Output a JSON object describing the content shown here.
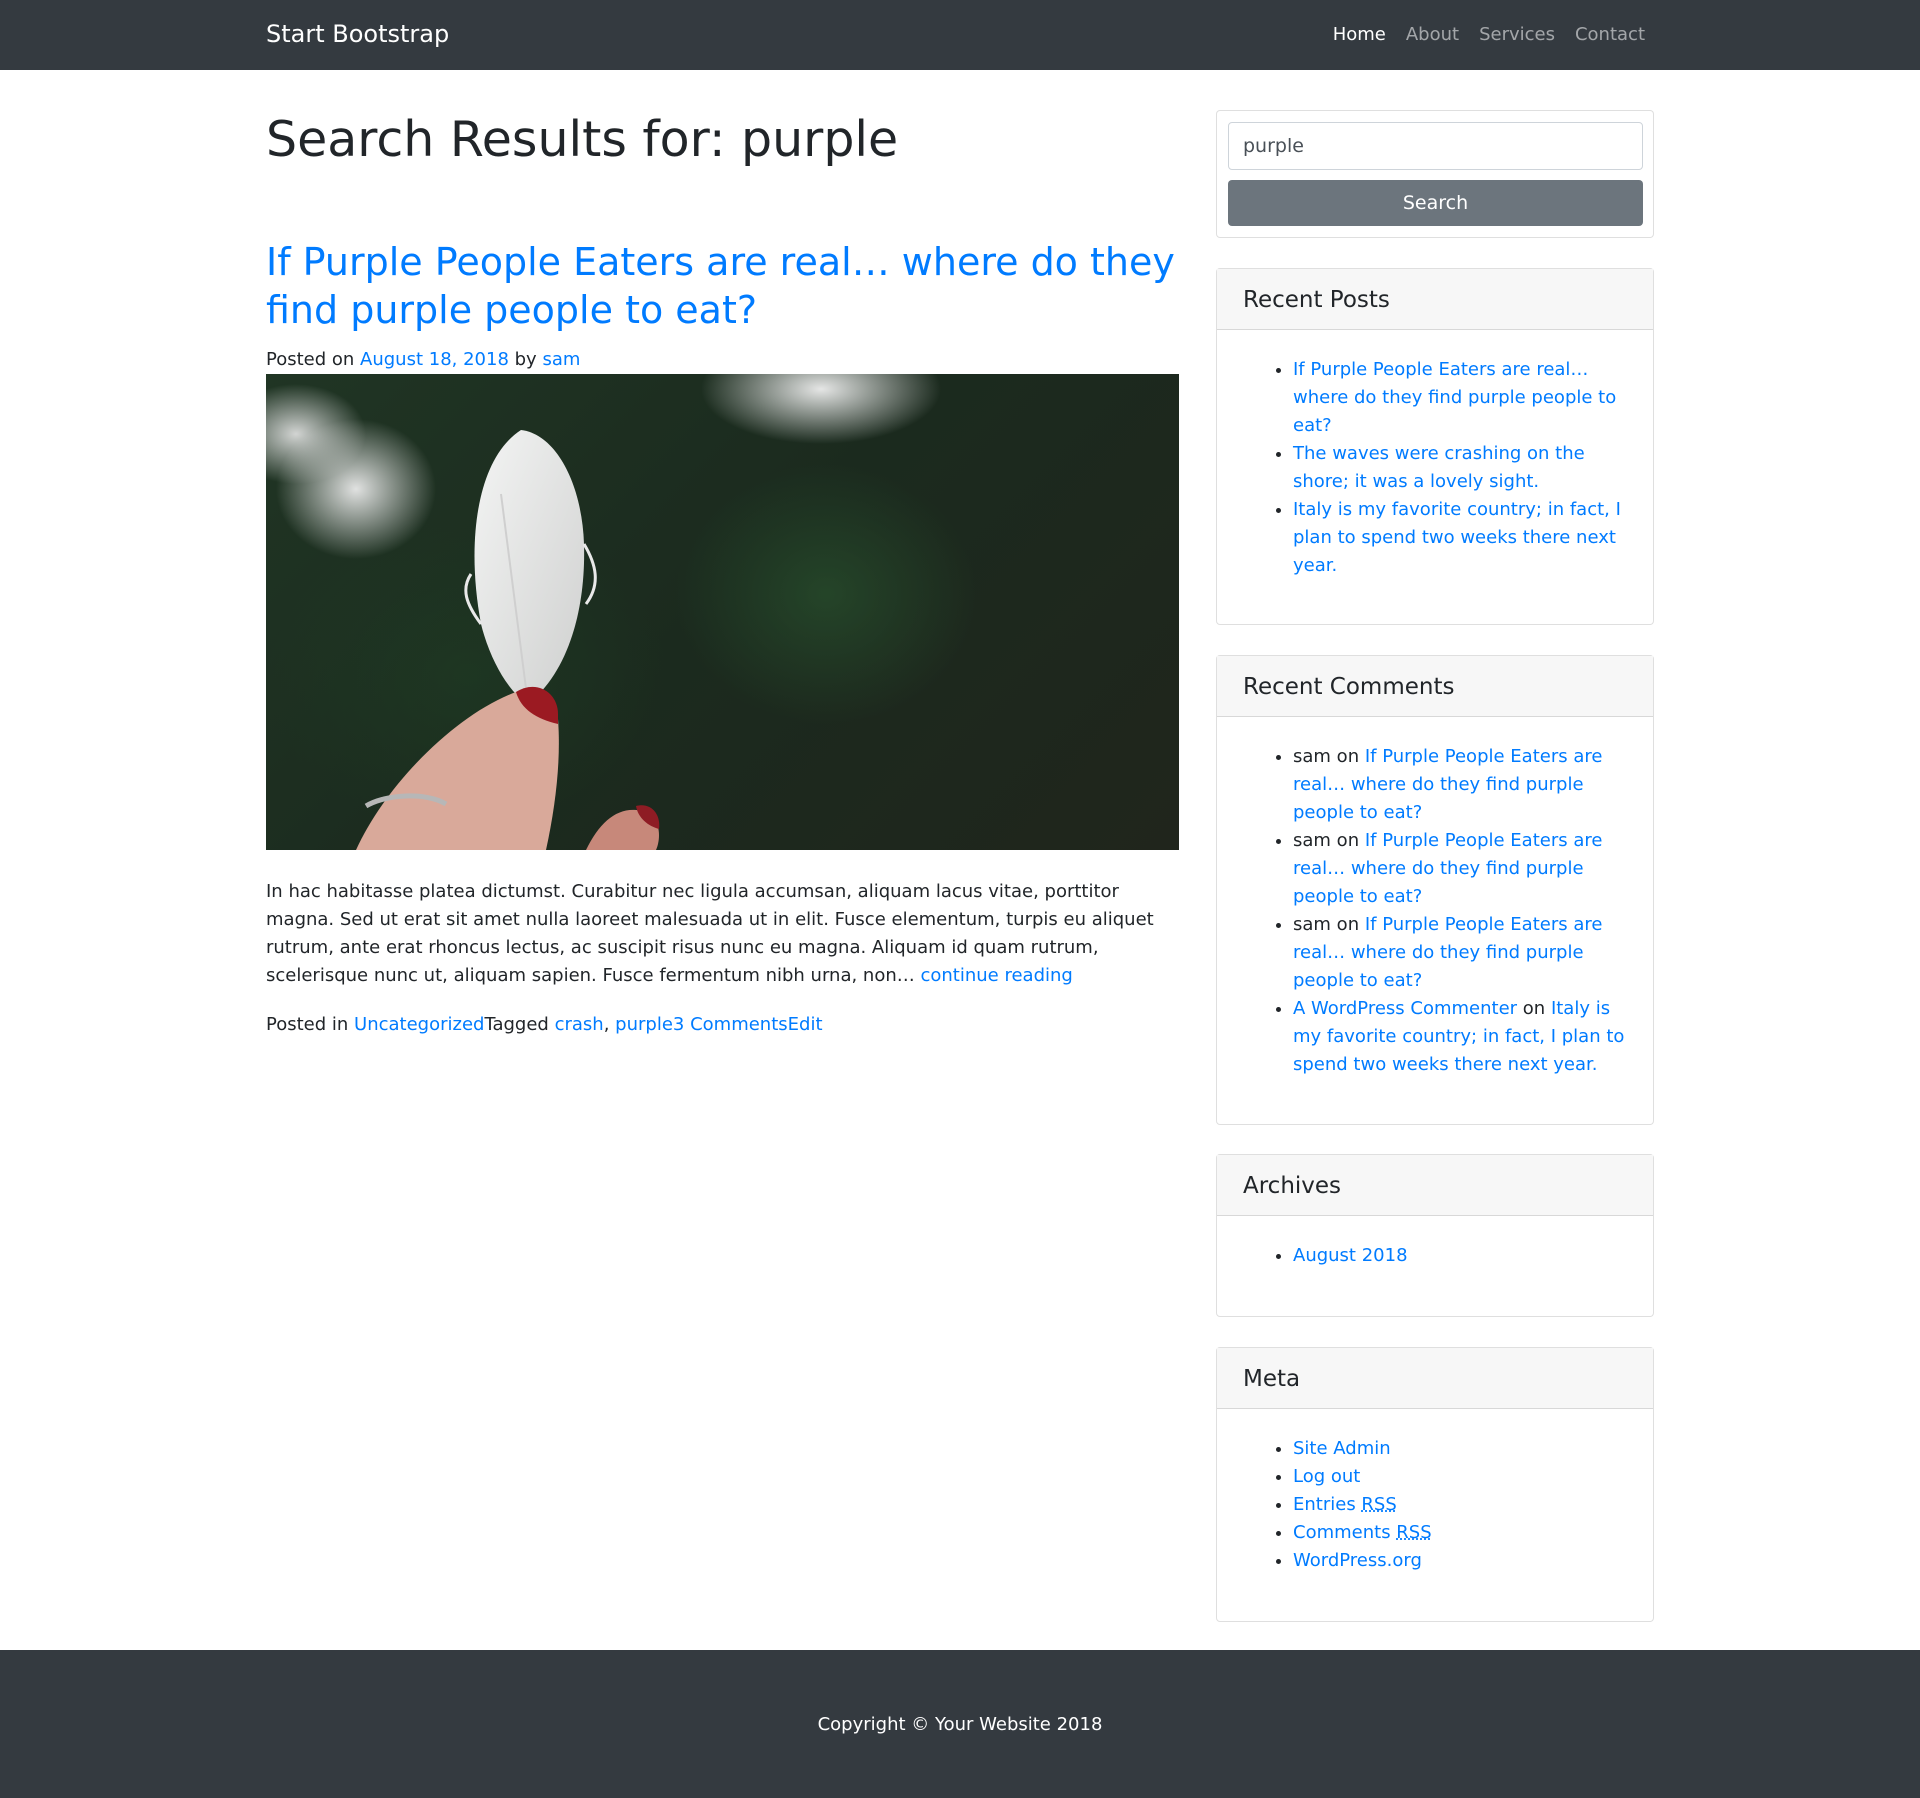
{
  "navbar": {
    "brand": "Start Bootstrap",
    "links": [
      {
        "label": "Home",
        "active": true
      },
      {
        "label": "About",
        "active": false
      },
      {
        "label": "Services",
        "active": false
      },
      {
        "label": "Contact",
        "active": false
      }
    ]
  },
  "main": {
    "page_title": "Search Results for: purple",
    "post": {
      "title": "If Purple People Eaters are real… where do they find purple people to eat?",
      "posted_on_label": "Posted on ",
      "date": "August 18, 2018",
      "by_label": " by ",
      "author": "sam",
      "excerpt": "In hac habitasse platea dictumst. Curabitur nec ligula accumsan, aliquam lacus vitae, porttitor magna. Sed ut erat sit amet nulla laoreet malesuada ut in elit. Fusce elementum, turpis eu aliquet rutrum, ante erat rhoncus lectus, ac suscipit risus nunc eu magna. Aliquam id quam rutrum, scelerisque nunc ut, aliquam sapien. Fusce fermentum nibh urna, non… ",
      "continue_label": "continue reading",
      "footer": {
        "posted_in_label": "Posted in ",
        "category": "Uncategorized",
        "tagged_label": "Tagged ",
        "tag1": "crash",
        "separator": ", ",
        "tag2": "purple",
        "comments": "3 Comments",
        "edit": "Edit"
      }
    }
  },
  "sidebar": {
    "search": {
      "value": "purple",
      "button_label": "Search"
    },
    "recent_posts": {
      "title": "Recent Posts",
      "items": [
        "If Purple People Eaters are real… where do they find purple people to eat?",
        "The waves were crashing on the shore; it was a lovely sight.",
        "Italy is my favorite country; in fact, I plan to spend two weeks there next year."
      ]
    },
    "recent_comments": {
      "title": "Recent Comments",
      "on_label": " on ",
      "items": [
        {
          "author": "sam",
          "post": "If Purple People Eaters are real… where do they find purple people to eat?"
        },
        {
          "author": "sam",
          "post": "If Purple People Eaters are real… where do they find purple people to eat?"
        },
        {
          "author": "sam",
          "post": "If Purple People Eaters are real… where do they find purple people to eat?"
        },
        {
          "author": "A WordPress Commenter",
          "post": "Italy is my favorite country; in fact, I plan to spend two weeks there next year."
        }
      ]
    },
    "archives": {
      "title": "Archives",
      "items": [
        "August 2018"
      ]
    },
    "meta": {
      "title": "Meta",
      "site_admin": "Site Admin",
      "log_out": "Log out",
      "entries_prefix": "Entries ",
      "comments_prefix": "Comments ",
      "rss": "RSS",
      "wordpress": "WordPress.org"
    }
  },
  "footer": {
    "copyright": "Copyright © Your Website 2018"
  },
  "colors": {
    "navbar_bg": "#343a40",
    "link": "#007bff",
    "button_secondary": "#6c757d"
  }
}
